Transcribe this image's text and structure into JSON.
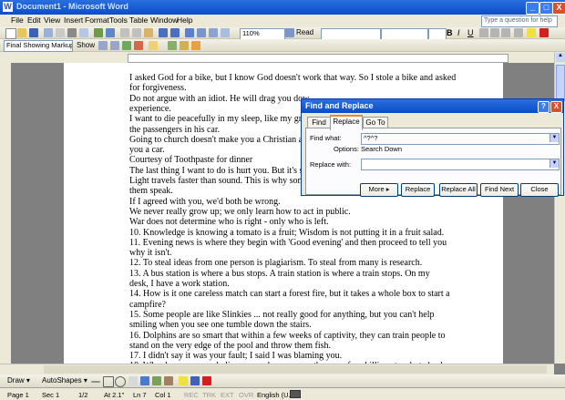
{
  "app": {
    "title": "Document1 - Microsoft Word",
    "app_icon": "W",
    "window_buttons": [
      "_",
      "□",
      "X"
    ]
  },
  "menu": {
    "items": [
      "File",
      "Edit",
      "View",
      "Insert",
      "Format",
      "Tools",
      "Table",
      "Window",
      "Help"
    ],
    "help_placeholder": "Type a question for help"
  },
  "toolbar": {
    "zoom": "110%",
    "read_label": "Read",
    "markup_mode": "Final Showing Markup",
    "show_label": "Show",
    "bold": "B",
    "italic": "I",
    "underline": "U"
  },
  "document": {
    "lines": [
      "I asked God for a bike, but I know God doesn't work that way. So I stole a bike and asked",
      "for forgiveness.",
      "Do not argue with an idiot. He will drag you dow",
      "experience.",
      "I want to die peacefully in my sleep, like my gran",
      "the passengers in his car.",
      "Going to church doesn't make you a Christian any",
      "you a car.",
      "      Courtesy of Toothpaste for dinner",
      "The last thing I want to do is hurt you. But it's stil",
      "Light travels faster than sound. This is why some",
      "them speak.",
      "If I agreed with you, we'd both be wrong.",
      "We never really grow up; we only learn how to act in public.",
      "War does not determine who is right - only who is left.",
      "  10. Knowledge is knowing a tomato is a fruit; Wisdom is not putting it in a fruit salad.",
      "  11. Evening news is where they begin with 'Good evening' and then proceed to tell you",
      "why it isn't.",
      "  12. To steal ideas from one person is plagiarism. To steal from many is research.",
      "  13. A bus station is where a bus stops. A train station is where a train stops. On my",
      "desk, I have a work station.",
      "  14. How is it one careless match can start a forest fire, but it takes a whole box to start a",
      "campfire?",
      "  15. Some people are like Slinkies ... not really good for anything, but you can't help",
      "smiling when you see one tumble down the stairs.",
      "  16. Dolphins are so smart that within a few weeks of captivity, they can train people to",
      "stand on the very edge of the pool and throw them fish.",
      "  17. I didn't say it was your fault; I said I was blaming you.",
      "  18. Why does someone believe you when you say there are four billion stars but check"
    ]
  },
  "dialog": {
    "title": "Find and Replace",
    "help_button": "?",
    "close_button": "X",
    "tabs": [
      "Find",
      "Replace",
      "Go To"
    ],
    "find_label": "Find what:",
    "find_value": "^?^?",
    "options_label": "Options:",
    "options_value": "Search Down",
    "replace_label": "Replace with:",
    "replace_value": "",
    "buttons": {
      "more": "More ▸",
      "replace": "Replace",
      "replace_all": "Replace All",
      "find_next": "Find Next",
      "close": "Close"
    }
  },
  "drawbar": {
    "draw": "Draw ▾",
    "autoshapes": "AutoShapes ▾"
  },
  "status": {
    "page": "Page 1",
    "sec": "Sec 1",
    "pages": "1/2",
    "at": "At 2.1\"",
    "ln": "Ln 7",
    "col": "Col 1",
    "rec": "REC",
    "trk": "TRK",
    "ext": "EXT",
    "ovr": "OVR",
    "lang": "English (U.S"
  },
  "colors": {
    "titlebar": "#0a4cc8",
    "chrome": "#ece9d8",
    "tab_accent": "#e68b2c"
  }
}
